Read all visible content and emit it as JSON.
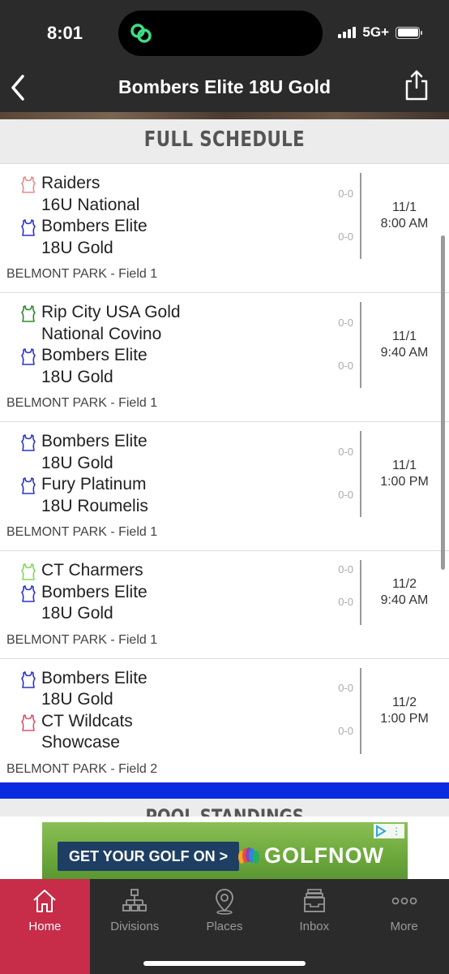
{
  "status": {
    "time": "8:01",
    "network": "5G+"
  },
  "nav": {
    "title": "Bombers Elite 18U Gold",
    "back_icon": "chevron-left-icon",
    "share_icon": "share-icon"
  },
  "section": {
    "title": "FULL SCHEDULE",
    "next_title": "POOL STANDINGS"
  },
  "colors": {
    "header_bg": "#2b2b2b",
    "active_tab": "#c72c48",
    "accent_blue": "#0a2be0"
  },
  "games": [
    {
      "team1": {
        "name": "Raiders\n16U National",
        "score": "0-0",
        "jersey_color": "#e88a8a"
      },
      "team2": {
        "name": "Bombers Elite\n18U Gold",
        "score": "0-0",
        "jersey_color": "#2a34c8"
      },
      "date": "11/1",
      "time": "8:00 AM",
      "venue": "BELMONT PARK - Field 1"
    },
    {
      "team1": {
        "name": "Rip City USA Gold\nNational Covino",
        "score": "0-0",
        "jersey_color": "#2e8b2e"
      },
      "team2": {
        "name": "Bombers Elite\n18U Gold",
        "score": "0-0",
        "jersey_color": "#2a34c8"
      },
      "date": "11/1",
      "time": "9:40 AM",
      "venue": "BELMONT PARK - Field 1"
    },
    {
      "team1": {
        "name": "Bombers Elite\n18U Gold",
        "score": "0-0",
        "jersey_color": "#2a34c8"
      },
      "team2": {
        "name": "Fury Platinum\n18U Roumelis",
        "score": "0-0",
        "jersey_color": "#2a34c8"
      },
      "date": "11/1",
      "time": "1:00 PM",
      "venue": "BELMONT PARK - Field 1"
    },
    {
      "team1": {
        "name": "CT Charmers",
        "score": "0-0",
        "jersey_color": "#7ed957"
      },
      "team2": {
        "name": "Bombers Elite\n18U Gold",
        "score": "0-0",
        "jersey_color": "#2a34c8"
      },
      "date": "11/2",
      "time": "9:40 AM",
      "venue": "BELMONT PARK - Field 1"
    },
    {
      "team1": {
        "name": "Bombers Elite\n18U Gold",
        "score": "0-0",
        "jersey_color": "#2a34c8"
      },
      "team2": {
        "name": "CT Wildcats\nShowcase",
        "score": "0-0",
        "jersey_color": "#d9536a"
      },
      "date": "11/2",
      "time": "1:00 PM",
      "venue": "BELMONT PARK - Field 2"
    }
  ],
  "ad": {
    "button_label": "GET YOUR GOLF ON >",
    "brand": "GOLFNOW"
  },
  "tabs": [
    {
      "label": "Home",
      "icon": "home-icon",
      "active": true
    },
    {
      "label": "Divisions",
      "icon": "divisions-icon",
      "active": false
    },
    {
      "label": "Places",
      "icon": "map-pin-icon",
      "active": false
    },
    {
      "label": "Inbox",
      "icon": "inbox-icon",
      "active": false
    },
    {
      "label": "More",
      "icon": "more-icon",
      "active": false
    }
  ]
}
